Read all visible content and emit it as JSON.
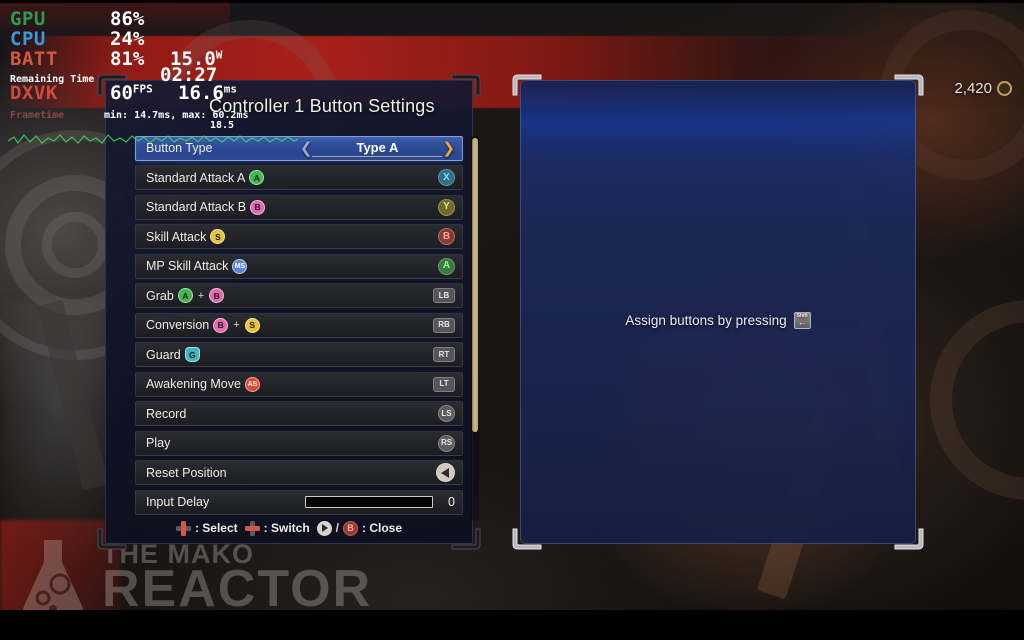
{
  "hud": {
    "gpu": {
      "label": "GPU",
      "value": "86",
      "unit": "%"
    },
    "cpu": {
      "label": "CPU",
      "value": "24",
      "unit": "%"
    },
    "batt": {
      "label": "BATT",
      "value": "81",
      "unit": "%",
      "power": "15.0",
      "power_unit": "W"
    },
    "remaining": {
      "label": "Remaining Time",
      "value": "02:27"
    },
    "dxvk": {
      "label": "DXVK",
      "fps": "60",
      "fps_unit": "FPS",
      "frametime": "16.6",
      "frametime_unit": "ms"
    },
    "minmax": "min: 14.7ms, max: 60.2ms",
    "overlap_value": "18.5",
    "frametime_label": "Frametime"
  },
  "currency": {
    "amount": "2,420",
    "icon": "coin-icon"
  },
  "left_panel": {
    "title": "Controller 1 Button Settings",
    "button_type": {
      "label": "Button Type",
      "value": "Type A",
      "left_arrow": "chevron-left-icon",
      "right_arrow": "chevron-right-icon"
    },
    "rows": [
      {
        "label": "Standard Attack A",
        "badges": [
          {
            "text": "A",
            "kind": "a"
          }
        ],
        "bind": "X",
        "bind_kind": "x"
      },
      {
        "label": "Standard Attack B",
        "badges": [
          {
            "text": "B",
            "kind": "b"
          }
        ],
        "bind": "Y",
        "bind_kind": "y"
      },
      {
        "label": "Skill Attack",
        "badges": [
          {
            "text": "S",
            "kind": "s"
          }
        ],
        "bind": "B",
        "bind_kind": "bb"
      },
      {
        "label": "MP Skill Attack",
        "badges": [
          {
            "text": "MS",
            "kind": "ms"
          }
        ],
        "bind": "A",
        "bind_kind": "aa"
      },
      {
        "label": "Grab",
        "badges": [
          {
            "text": "A",
            "kind": "a"
          },
          {
            "text": "+",
            "kind": "plus"
          },
          {
            "text": "B",
            "kind": "b"
          }
        ],
        "bind": "LB",
        "bind_kind": "shoulder"
      },
      {
        "label": "Conversion",
        "badges": [
          {
            "text": "B",
            "kind": "b"
          },
          {
            "text": "+",
            "kind": "plus"
          },
          {
            "text": "S",
            "kind": "s"
          }
        ],
        "bind": "RB",
        "bind_kind": "shoulder"
      },
      {
        "label": "Guard",
        "badges": [
          {
            "text": "G",
            "kind": "g"
          }
        ],
        "bind": "RT",
        "bind_kind": "shoulder"
      },
      {
        "label": "Awakening Move",
        "badges": [
          {
            "text": "AS",
            "kind": "as"
          }
        ],
        "bind": "LT",
        "bind_kind": "shoulder"
      },
      {
        "label": "Record",
        "badges": [],
        "bind": "LS",
        "bind_kind": "stick"
      },
      {
        "label": "Play",
        "badges": [],
        "bind": "RS",
        "bind_kind": "stick"
      },
      {
        "label": "Reset Position",
        "badges": [],
        "bind": "",
        "bind_kind": "tri"
      }
    ],
    "input_delay": {
      "label": "Input Delay",
      "value": "0"
    },
    "legend": {
      "select": {
        "icon": "dpad-vertical-icon",
        "text": ": Select"
      },
      "switch": {
        "icon": "dpad-horizontal-icon",
        "text": ": Switch"
      },
      "close_play_icon": "play-button-icon",
      "separator": "/",
      "close_b": "B",
      "close_text": ": Close"
    }
  },
  "right_panel": {
    "assign_text": "Assign buttons by pressing",
    "key": {
      "top": "Shift",
      "arrow": "←"
    }
  },
  "watermark": {
    "line1": "THE MAKO",
    "line2": "REACTOR",
    "logo": "flask-logo-icon"
  }
}
